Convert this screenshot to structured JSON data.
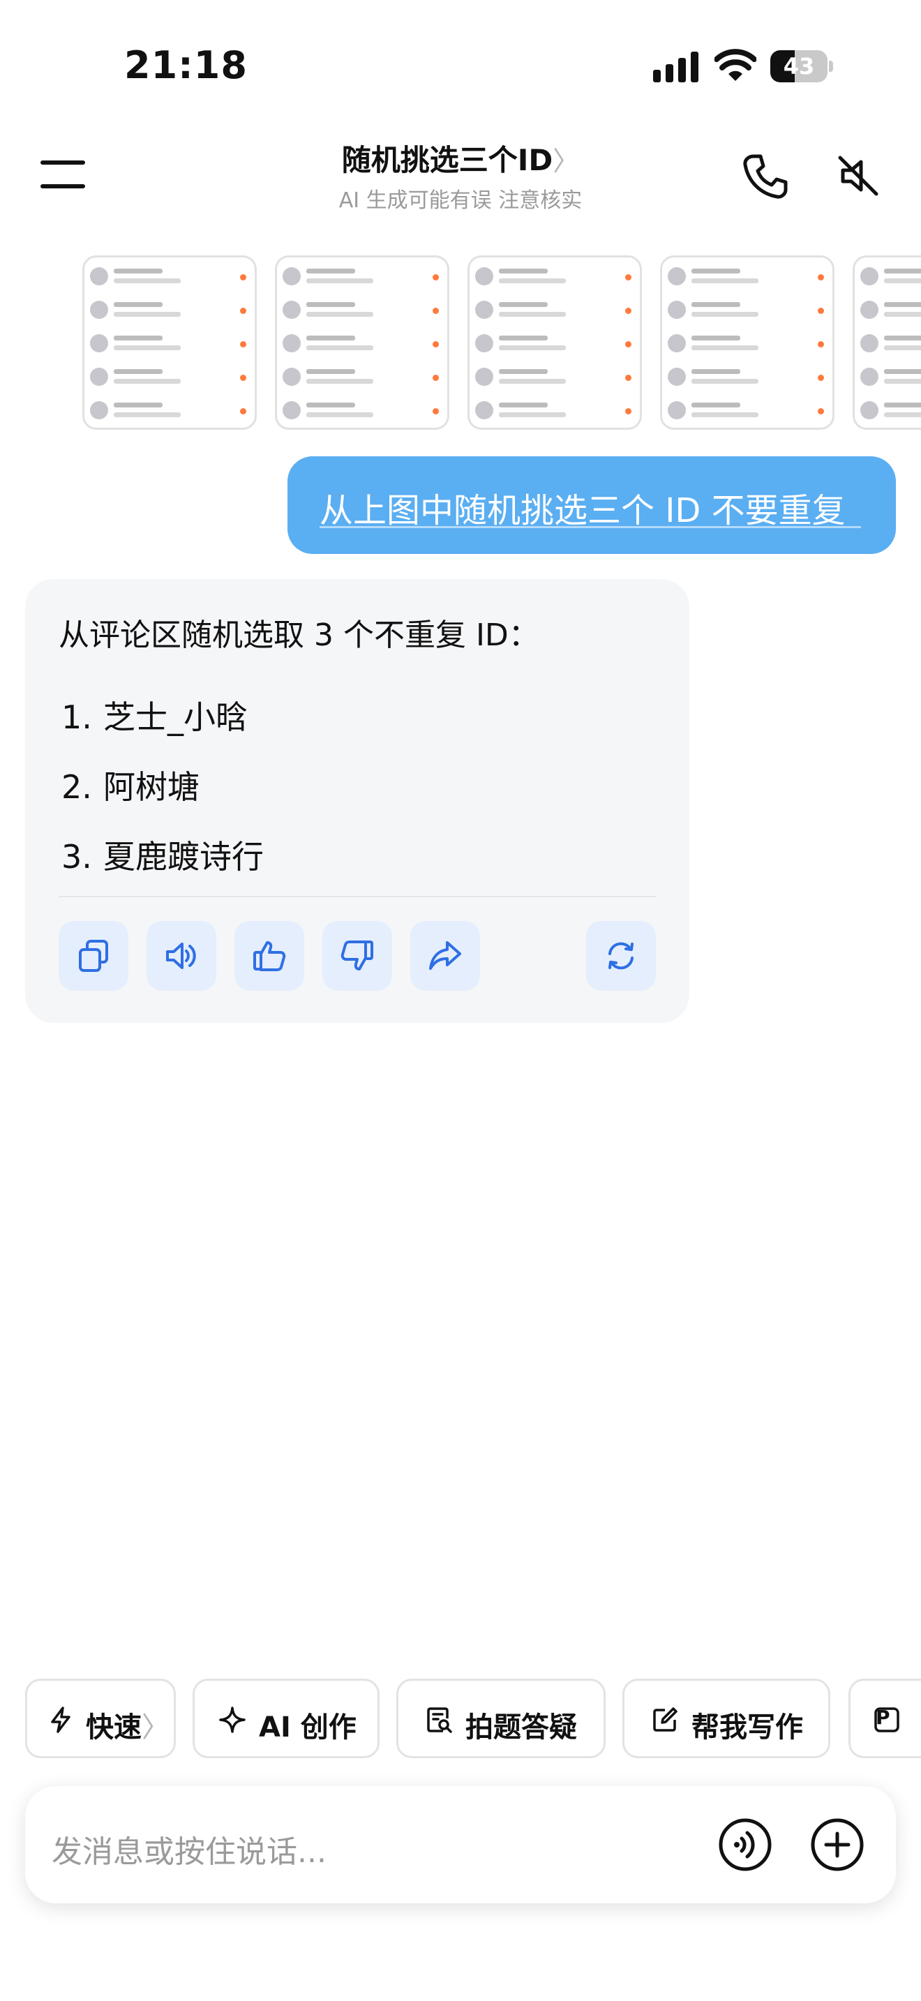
{
  "status_bar": {
    "time": "21:18",
    "battery": "43",
    "battery_level": 0.43
  },
  "header": {
    "title": "随机挑选三个ID",
    "title_chevron": "〉",
    "subtitle": "AI 生成可能有误 注意核实",
    "icons": [
      "menu-icon",
      "phone-icon",
      "speaker-mute-icon"
    ]
  },
  "user_message": {
    "text": "从上图中随机挑选三个 ID 不要重复"
  },
  "bot_message": {
    "intro": "从评论区随机选取 3 个不重复 ID：",
    "items": [
      {
        "num": "1.",
        "text": "芝士_小晗"
      },
      {
        "num": "2.",
        "text": "阿树塘"
      },
      {
        "num": "3.",
        "text": "夏鹿踱诗行"
      }
    ],
    "actions": [
      "copy-icon",
      "read-aloud-icon",
      "thumbs-up-icon",
      "thumbs-down-icon",
      "share-icon",
      "regenerate-icon"
    ]
  },
  "quick_chips": [
    {
      "label": "快速",
      "chevron": "〉",
      "icon": "lightning-icon"
    },
    {
      "label": "AI 创作",
      "icon": "sparkle-icon"
    },
    {
      "label": "拍题答疑",
      "icon": "doc-search-icon"
    },
    {
      "label": "帮我写作",
      "icon": "edit-icon"
    },
    {
      "label": "P",
      "icon": "p-icon"
    }
  ],
  "input": {
    "placeholder": "发消息或按住说话..."
  },
  "colors": {
    "user_bubble": "#5aaef2",
    "bot_card": "#f5f6f8",
    "action_button": "#e5eefd",
    "action_icon": "#2f6fe4",
    "secondary_text": "#9a9a9a"
  }
}
